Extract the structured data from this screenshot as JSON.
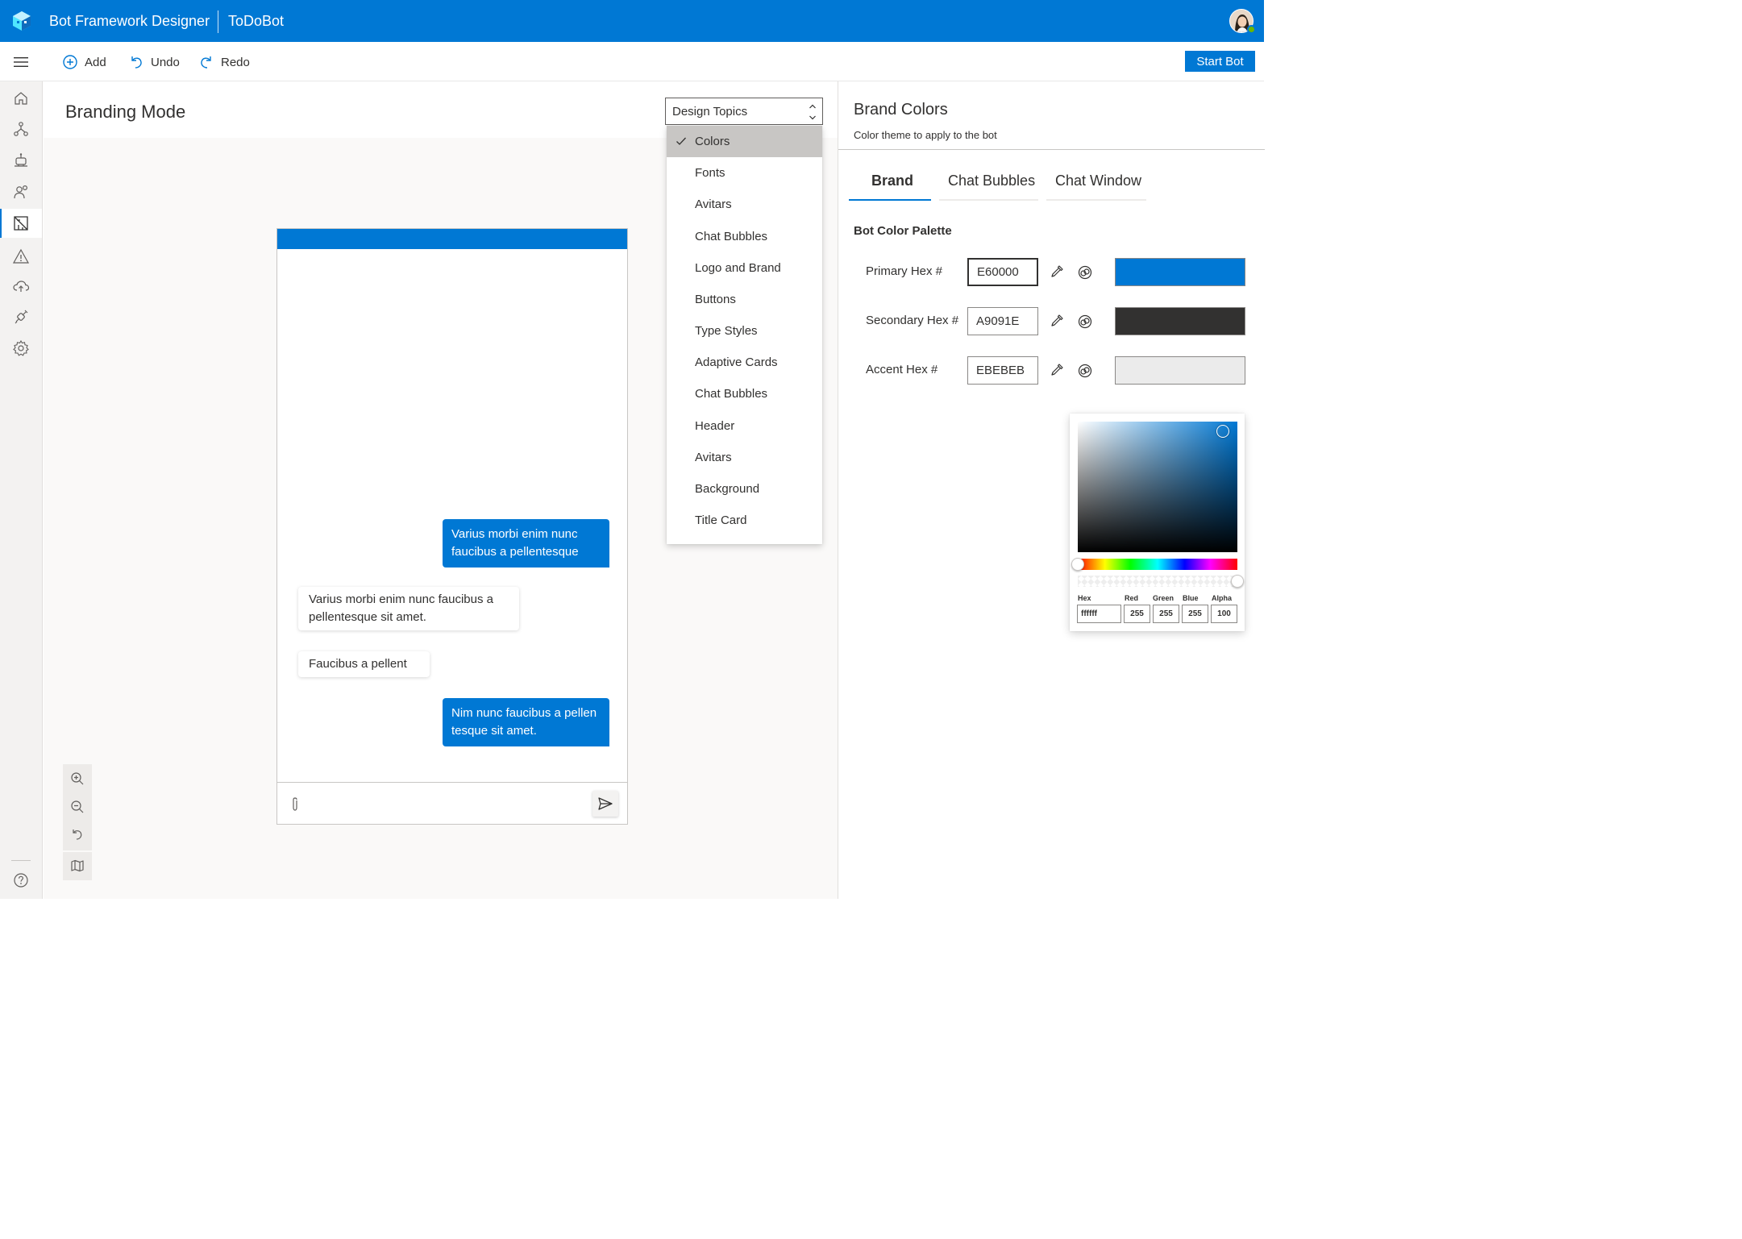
{
  "app": {
    "title": "Bot Framework Designer",
    "bot_name": "ToDoBot"
  },
  "toolbar": {
    "add_label": "Add",
    "undo_label": "Undo",
    "redo_label": "Redo",
    "start_label": "Start Bot"
  },
  "page": {
    "title": "Branding Mode"
  },
  "topics": {
    "selected_label": "Design Topics",
    "items": [
      {
        "label": "Colors",
        "selected": true
      },
      {
        "label": "Fonts"
      },
      {
        "label": "Avitars"
      },
      {
        "label": "Chat Bubbles"
      },
      {
        "label": "Logo and Brand"
      },
      {
        "label": "Buttons"
      },
      {
        "label": "Type Styles"
      },
      {
        "label": "Adaptive Cards"
      },
      {
        "label": "Chat Bubbles"
      },
      {
        "label": "Header"
      },
      {
        "label": "Avitars"
      },
      {
        "label": "Background"
      },
      {
        "label": "Title Card"
      }
    ]
  },
  "chat": {
    "messages": [
      {
        "from": "user",
        "line1": "Varius morbi enim nunc",
        "line2": "faucibus a pellentesque"
      },
      {
        "from": "bot",
        "line1": "Varius morbi enim nunc faucibus a",
        "line2": "pellentesque sit amet."
      },
      {
        "from": "bot",
        "line1": "Faucibus a pellent"
      },
      {
        "from": "user",
        "line1": "Nim nunc faucibus a pellen",
        "line2": "tesque sit amet."
      }
    ]
  },
  "panel": {
    "title": "Brand Colors",
    "subtitle": "Color theme to apply to the bot",
    "tabs": [
      "Brand",
      "Chat Bubbles",
      "Chat Window"
    ],
    "active_tab": "Brand",
    "section_label": "Bot Color Palette",
    "rows": [
      {
        "label": "Primary Hex #",
        "value": "E60000",
        "swatch": "#0078d4"
      },
      {
        "label": "Secondary Hex #",
        "value": "A9091E",
        "swatch": "#323130"
      },
      {
        "label": "Accent Hex #",
        "value": "EBEBEB",
        "swatch": "#ebebeb"
      }
    ]
  },
  "picker": {
    "labels": {
      "hex": "Hex",
      "red": "Red",
      "green": "Green",
      "blue": "Blue",
      "alpha": "Alpha"
    },
    "values": {
      "hex": "ffffff",
      "red": "255",
      "green": "255",
      "blue": "255",
      "alpha": "100"
    }
  },
  "colors": {
    "brand": "#0078d4",
    "nav_bg": "#f3f2f1",
    "text": "#323130"
  },
  "icons": {
    "nav": [
      "home-icon",
      "flow-icon",
      "bot-icon",
      "users-icon",
      "design-icon",
      "warning-icon",
      "cloud-upload-icon",
      "plug-icon",
      "settings-icon",
      "help-icon"
    ]
  }
}
